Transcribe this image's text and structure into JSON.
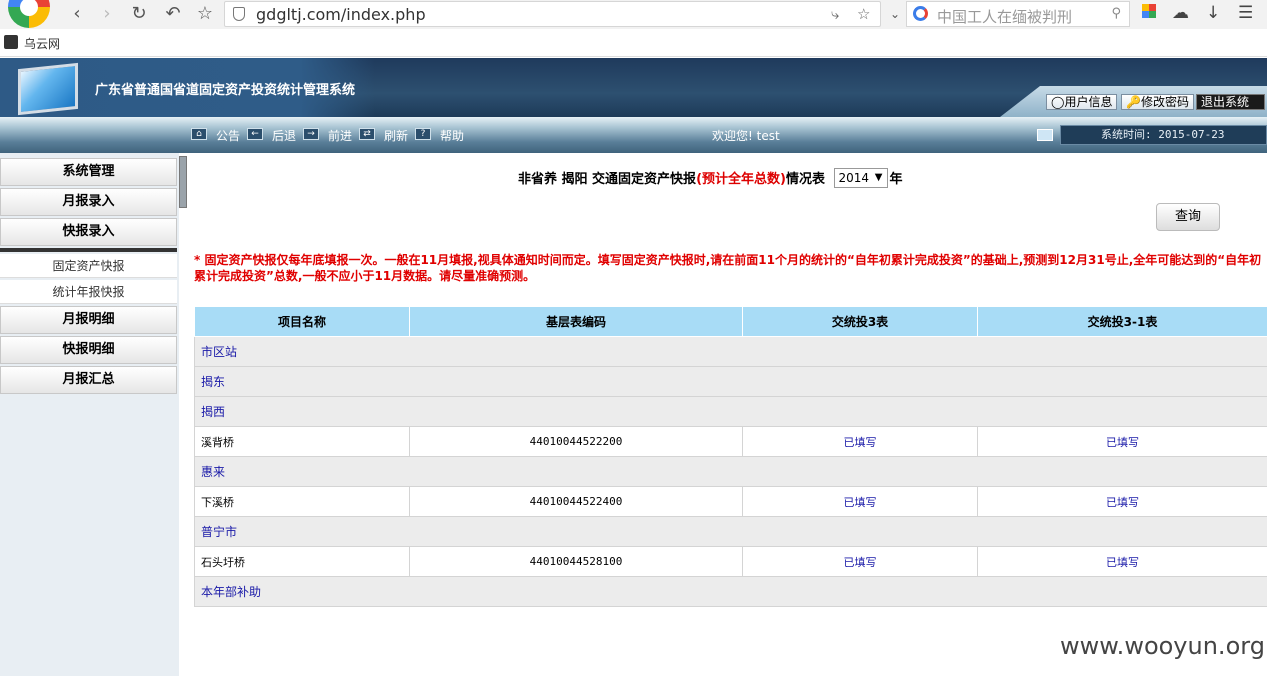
{
  "browser": {
    "url": "gdgltj.com/index.php",
    "search_placeholder": "中国工人在缅被判刑",
    "bookmark": "乌云网"
  },
  "header": {
    "title": "广东省普通国省道固定资产投资统计管理系统",
    "user_info": "用户信息",
    "change_password": "修改密码",
    "logout": "退出系统"
  },
  "toolbar": {
    "announce": "公告",
    "back": "后退",
    "forward": "前进",
    "refresh": "刷新",
    "help": "帮助",
    "welcome": "欢迎您! test",
    "system_time": "系统时间: 2015-07-23"
  },
  "sidebar": {
    "system": "系统管理",
    "monthly_entry": "月报录入",
    "quick_entry": "快报录入",
    "sub_fixed_asset": "固定资产快报",
    "sub_annual_stat": "统计年报快报",
    "monthly_detail": "月报明细",
    "quick_detail": "快报明细",
    "monthly_summary": "月报汇总"
  },
  "main": {
    "heading_prefix": "非省养 揭阳 交通固定资产快报",
    "heading_red": "(预计全年总数)",
    "heading_suffix": "情况表",
    "year": "2014",
    "year_unit": "年",
    "query": "查询",
    "notice": "* 固定资产快报仅每年底填报一次。一般在11月填报,视具体通知时间而定。填写固定资产快报时,请在前面11个月的统计的“自年初累计完成投资”的基础上,预测到12月31号止,全年可能达到的“自年初累计完成投资”总数,一般不应小于11月数据。请尽量准确预测。"
  },
  "table": {
    "columns": [
      "项目名称",
      "基层表编码",
      "交统投3表",
      "交统投3-1表"
    ],
    "rows": [
      {
        "type": "group",
        "name": "市区站"
      },
      {
        "type": "group",
        "name": "揭东"
      },
      {
        "type": "group",
        "name": "揭西"
      },
      {
        "type": "item",
        "name": "溪背桥",
        "code": "44010044522200",
        "t3": "已填写",
        "t31": "已填写"
      },
      {
        "type": "group",
        "name": "惠来"
      },
      {
        "type": "item",
        "name": "下溪桥",
        "code": "44010044522400",
        "t3": "已填写",
        "t31": "已填写"
      },
      {
        "type": "group",
        "name": "普宁市"
      },
      {
        "type": "item",
        "name": "石头圩桥",
        "code": "44010044528100",
        "t3": "已填写",
        "t31": "已填写"
      },
      {
        "type": "group",
        "name": "本年部补助"
      }
    ]
  },
  "watermark": "www.wooyun.org"
}
